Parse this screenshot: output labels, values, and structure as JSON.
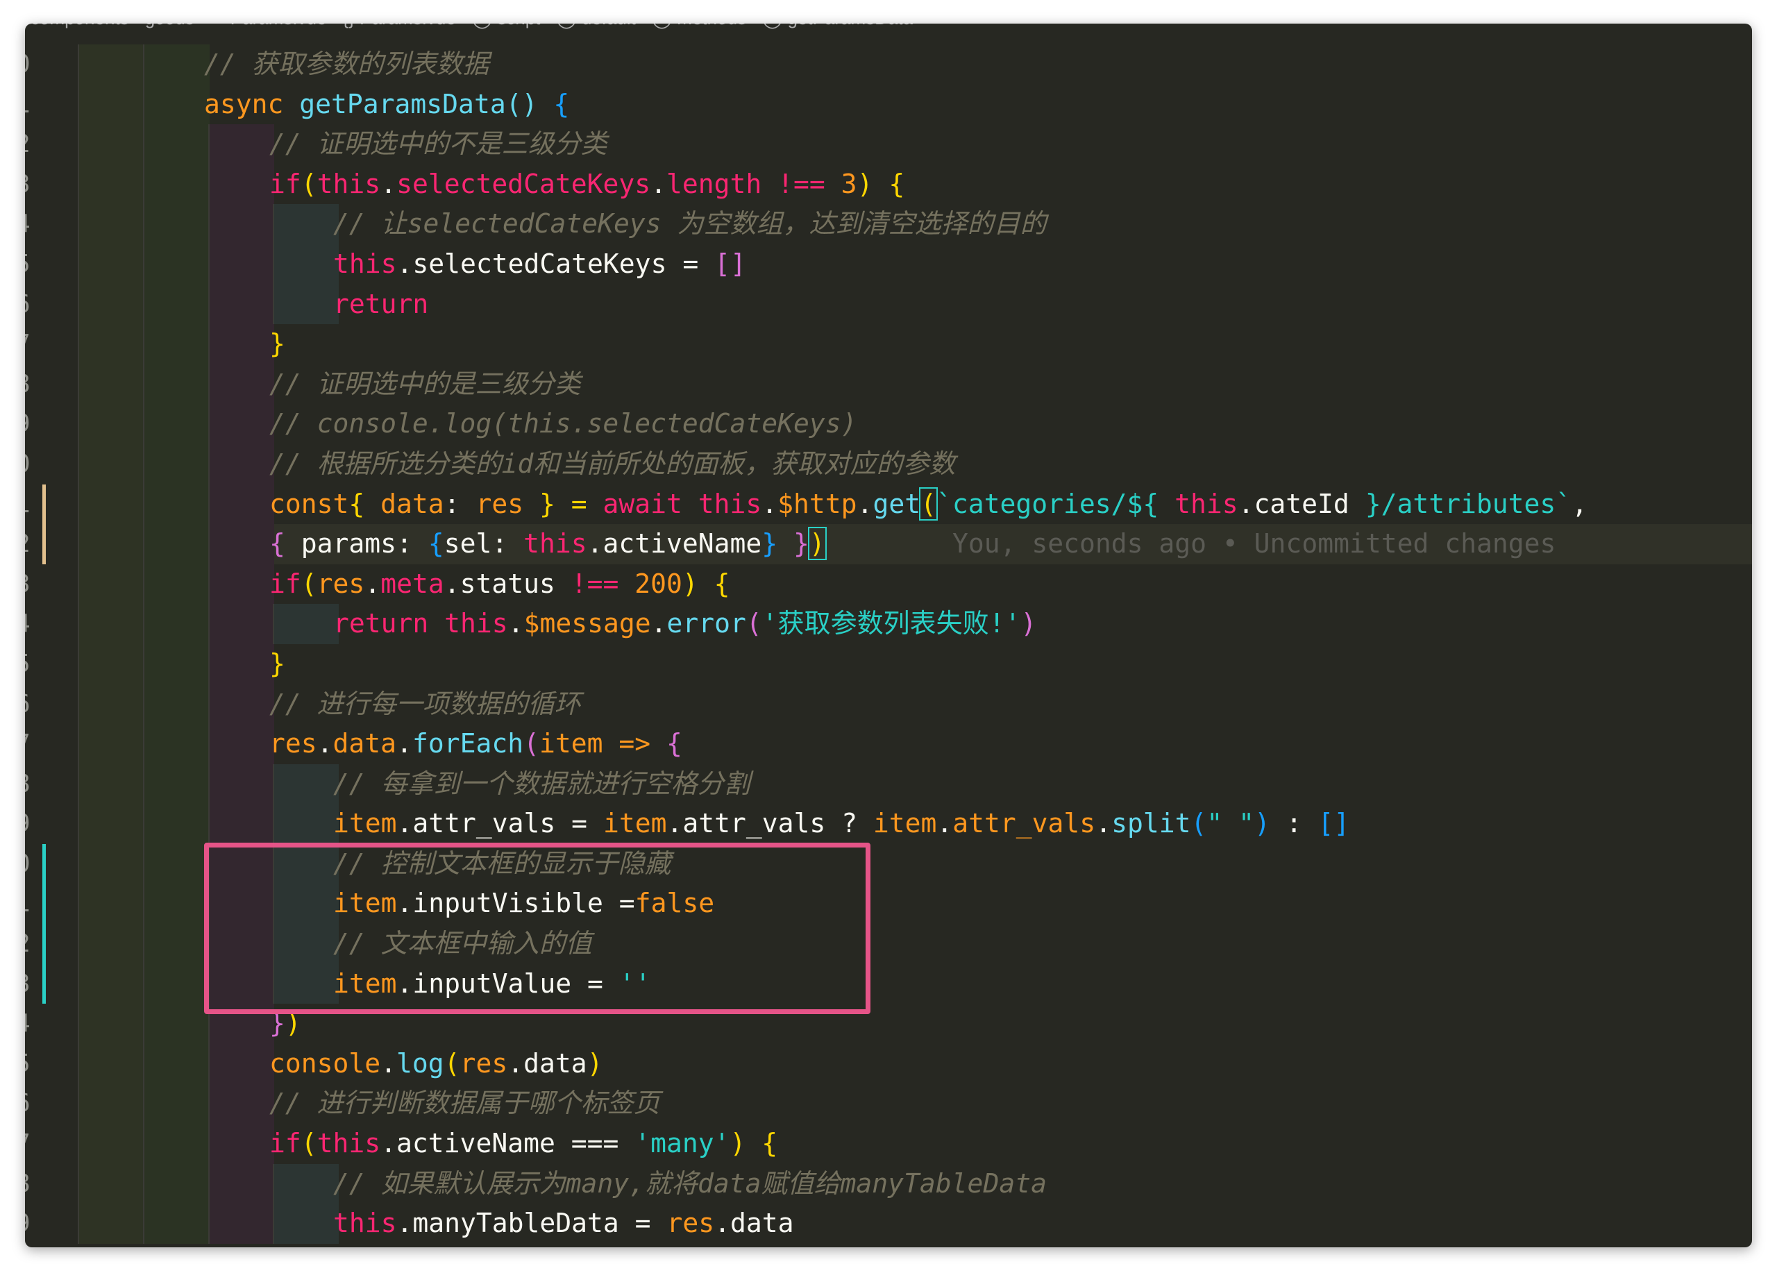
{
  "breadcrumb": {
    "text": "components › goods › ✓ Params.vue › {} Params.vue › ◯ script › ◯ default › ◯ methods › ◯ getParamsData"
  },
  "editor": {
    "blame_annotation": "You, seconds ago • Uncommitted changes",
    "line_numbers": [
      "0",
      "1",
      "2",
      "3",
      "4",
      "5",
      "6",
      "7",
      "8",
      "9",
      "0",
      "1",
      "2",
      "3",
      "4",
      "5",
      "6",
      "7",
      "8",
      "9",
      "0",
      "1",
      "2",
      "3",
      "4",
      "5",
      "6",
      "7",
      "8",
      "9"
    ],
    "lines": [
      {
        "tokens": [
          {
            "t": "// 获取参数的列表数据"
          }
        ]
      },
      {
        "tokens": [
          {
            "t": "async "
          },
          {
            "t": "getParamsData"
          },
          {
            "t": "() "
          },
          {
            "t": "{"
          }
        ]
      },
      {
        "tokens": [
          {
            "t": "// 证明选中的不是三级分类"
          }
        ]
      },
      {
        "tokens": [
          {
            "t": "if"
          },
          {
            "t": "("
          },
          {
            "t": "this"
          },
          {
            "t": "."
          },
          {
            "t": "selectedCateKeys"
          },
          {
            "t": "."
          },
          {
            "t": "length"
          },
          {
            "t": " !== "
          },
          {
            "t": "3"
          },
          {
            "t": ") "
          },
          {
            "t": "{"
          }
        ]
      },
      {
        "tokens": [
          {
            "t": "// 让selectedCateKeys 为空数组，达到清空选择的目的"
          }
        ]
      },
      {
        "tokens": [
          {
            "t": "this"
          },
          {
            "t": ".selectedCateKeys = "
          },
          {
            "t": "[]"
          }
        ]
      },
      {
        "tokens": [
          {
            "t": "return"
          }
        ]
      },
      {
        "tokens": [
          {
            "t": "}"
          }
        ]
      },
      {
        "tokens": [
          {
            "t": "// 证明选中的是三级分类"
          }
        ]
      },
      {
        "tokens": [
          {
            "t": "// console.log(this.selectedCateKeys)"
          }
        ]
      },
      {
        "tokens": [
          {
            "t": "// 根据所选分类的id和当前所处的面板，获取对应的参数"
          }
        ]
      },
      {
        "tokens": [
          {
            "t": "const"
          },
          {
            "t": "{ "
          },
          {
            "t": "data"
          },
          {
            "t": ": "
          },
          {
            "t": "res"
          },
          {
            "t": " } = "
          },
          {
            "t": "await "
          },
          {
            "t": "this"
          },
          {
            "t": "."
          },
          {
            "t": "$http"
          },
          {
            "t": "."
          },
          {
            "t": "get"
          },
          {
            "t": "("
          },
          {
            "t": "`categories/${ "
          },
          {
            "t": "this"
          },
          {
            "t": "."
          },
          {
            "t": "cateId"
          },
          {
            "t": " }/attributes`"
          },
          {
            "t": ","
          }
        ]
      },
      {
        "tokens": [
          {
            "t": "{ "
          },
          {
            "t": "params: "
          },
          {
            "t": "{"
          },
          {
            "t": "sel: "
          },
          {
            "t": "this"
          },
          {
            "t": "."
          },
          {
            "t": "activeName"
          },
          {
            "t": "} "
          },
          {
            "t": "}"
          },
          {
            "t": ")"
          }
        ]
      },
      {
        "tokens": [
          {
            "t": "if"
          },
          {
            "t": "("
          },
          {
            "t": "res"
          },
          {
            "t": "."
          },
          {
            "t": "meta"
          },
          {
            "t": "."
          },
          {
            "t": "status"
          },
          {
            "t": " !== "
          },
          {
            "t": "200"
          },
          {
            "t": ") "
          },
          {
            "t": "{"
          }
        ]
      },
      {
        "tokens": [
          {
            "t": "return "
          },
          {
            "t": "this"
          },
          {
            "t": "."
          },
          {
            "t": "$message"
          },
          {
            "t": "."
          },
          {
            "t": "error"
          },
          {
            "t": "("
          },
          {
            "t": "'获取参数列表失败!'"
          },
          {
            "t": ")"
          }
        ]
      },
      {
        "tokens": [
          {
            "t": "}"
          }
        ]
      },
      {
        "tokens": [
          {
            "t": "// 进行每一项数据的循环"
          }
        ]
      },
      {
        "tokens": [
          {
            "t": "res"
          },
          {
            "t": "."
          },
          {
            "t": "data"
          },
          {
            "t": "."
          },
          {
            "t": "forEach"
          },
          {
            "t": "("
          },
          {
            "t": "item"
          },
          {
            "t": " => "
          },
          {
            "t": "{"
          }
        ]
      },
      {
        "tokens": [
          {
            "t": "// 每拿到一个数据就进行空格分割"
          }
        ]
      },
      {
        "tokens": [
          {
            "t": "item"
          },
          {
            "t": ".attr_vals = "
          },
          {
            "t": "item"
          },
          {
            "t": ".attr_vals ? "
          },
          {
            "t": "item"
          },
          {
            "t": "."
          },
          {
            "t": "attr_vals"
          },
          {
            "t": "."
          },
          {
            "t": "split"
          },
          {
            "t": "("
          },
          {
            "t": "\" \""
          },
          {
            "t": ")"
          },
          {
            "t": " : "
          },
          {
            "t": "[]"
          }
        ]
      },
      {
        "tokens": [
          {
            "t": "// 控制文本框的显示于隐藏"
          }
        ]
      },
      {
        "tokens": [
          {
            "t": "item"
          },
          {
            "t": ".inputVisible ="
          },
          {
            "t": "false"
          }
        ]
      },
      {
        "tokens": [
          {
            "t": "// 文本框中输入的值"
          }
        ]
      },
      {
        "tokens": [
          {
            "t": "item"
          },
          {
            "t": ".inputValue = "
          },
          {
            "t": "''"
          }
        ]
      },
      {
        "tokens": [
          {
            "t": "}"
          },
          {
            "t": ")"
          }
        ]
      },
      {
        "tokens": [
          {
            "t": "console"
          },
          {
            "t": "."
          },
          {
            "t": "log"
          },
          {
            "t": "("
          },
          {
            "t": "res"
          },
          {
            "t": ".data"
          },
          {
            "t": ")"
          }
        ]
      },
      {
        "tokens": [
          {
            "t": "// 进行判断数据属于哪个标签页"
          }
        ]
      },
      {
        "tokens": [
          {
            "t": "if"
          },
          {
            "t": "("
          },
          {
            "t": "this"
          },
          {
            "t": ".activeName === "
          },
          {
            "t": "'many'"
          },
          {
            "t": ") "
          },
          {
            "t": "{"
          }
        ]
      },
      {
        "tokens": [
          {
            "t": "// 如果默认展示为many,就将data赋值给manyTableData"
          }
        ]
      },
      {
        "tokens": [
          {
            "t": "this"
          },
          {
            "t": ".manyTableData = "
          },
          {
            "t": "res"
          },
          {
            "t": ".data"
          }
        ]
      }
    ]
  }
}
